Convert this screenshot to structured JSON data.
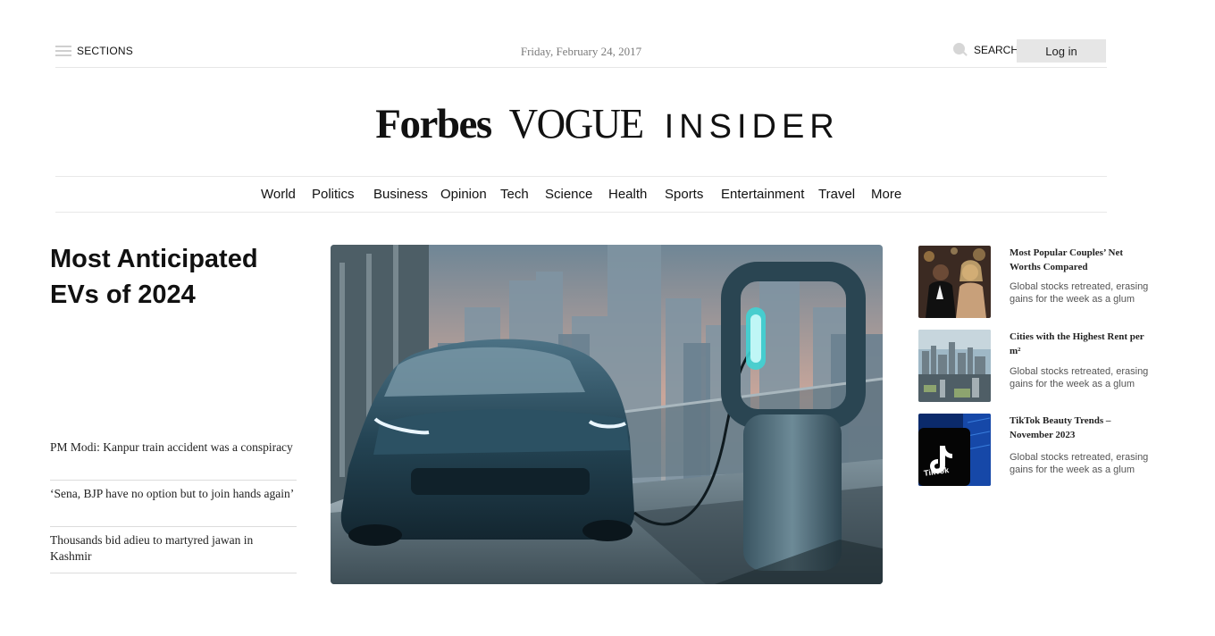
{
  "topbar": {
    "sections_label": "SECTIONS",
    "date": "Friday, February 24, 2017",
    "search_label": "SEARCH",
    "login_label": "Log in"
  },
  "masthead": {
    "brand_1": "Forbes",
    "brand_2": "VOGUE",
    "brand_3": "INSIDER"
  },
  "nav": {
    "items": [
      "World",
      "Politics",
      "Business",
      "Opinion",
      "Tech",
      "Science",
      "Health",
      "Sports",
      "Entertainment",
      "Travel",
      "More"
    ]
  },
  "main": {
    "headline": "Most Anticipated EVs of 2024",
    "side_stories": [
      "PM Modi: Kanpur train accident was a conspiracy",
      "‘Sena, BJP have no option but to join hands again’",
      "Thousands bid adieu to martyred jawan in Kashmir"
    ]
  },
  "right": {
    "stories": [
      {
        "title": "Most Popular Couples’ Net Worths Compared",
        "desc": "Global stocks retreated, erasing gains for the week as a glum"
      },
      {
        "title": "Cities with the Highest Rent per m²",
        "desc": "Global stocks retreated, erasing gains for the week as a glum"
      },
      {
        "title": "TikTok Beauty Trends – November 2023",
        "desc": "Global stocks retreated, erasing gains for the week as a glum",
        "thumb_logo_text": "TikTok"
      }
    ]
  },
  "colors": {
    "divider": "#e6e6e6",
    "login_bg": "#e6e6e6",
    "date_text": "#7a7a7a",
    "ev_teal": "#3fd3d4"
  },
  "icons": [
    "hamburger-icon",
    "search-icon",
    "tiktok-icon"
  ]
}
